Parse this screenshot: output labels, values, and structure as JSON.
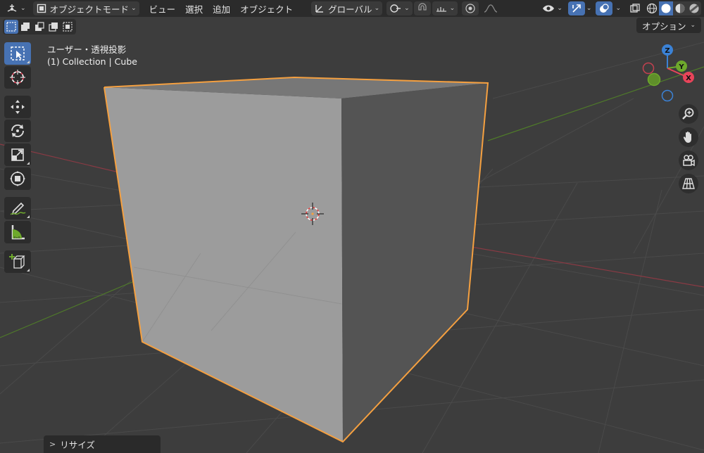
{
  "header": {
    "mode_label": "オブジェクトモード",
    "menus": [
      "ビュー",
      "選択",
      "追加",
      "オブジェクト"
    ],
    "transform_orientation": "グローバル"
  },
  "options_label": "オプション",
  "viewport": {
    "title": "ユーザー・透視投影",
    "subtitle": "(1) Collection | Cube"
  },
  "gizmo": {
    "z": "Z",
    "y": "Y",
    "x": "X"
  },
  "redo_panel": {
    "label": "リサイズ"
  },
  "colors": {
    "header_bg": "#2b2b2b",
    "viewport_bg": "#3d3d3d",
    "accent_blue": "#4772b3",
    "selection_outline": "#f5a040",
    "axis_x": "#e8445a",
    "axis_y": "#6ea92c",
    "axis_z": "#3b82d6"
  },
  "tools": [
    {
      "name": "select-box-tool",
      "icon": "select-box-icon",
      "active": true
    },
    {
      "name": "cursor-tool",
      "icon": "cursor-icon",
      "active": false
    },
    {
      "name": "move-tool",
      "icon": "move-icon",
      "active": false
    },
    {
      "name": "rotate-tool",
      "icon": "rotate-icon",
      "active": false
    },
    {
      "name": "scale-tool",
      "icon": "scale-icon",
      "active": false
    },
    {
      "name": "transform-tool",
      "icon": "transform-icon",
      "active": false
    },
    {
      "name": "annotate-tool",
      "icon": "annotate-icon",
      "active": false
    },
    {
      "name": "measure-tool",
      "icon": "measure-icon",
      "active": false
    },
    {
      "name": "add-cube-tool",
      "icon": "add-cube-icon",
      "active": false
    }
  ]
}
